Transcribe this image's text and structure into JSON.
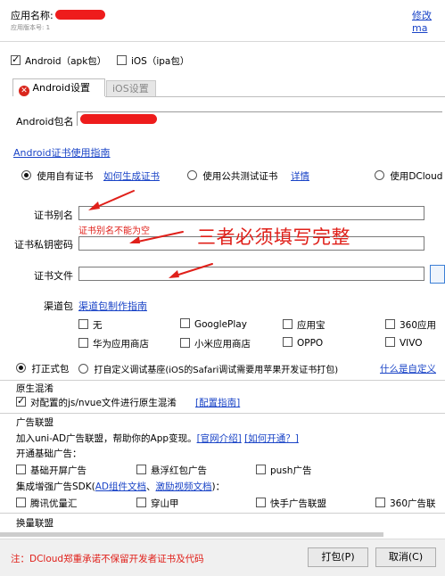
{
  "header": {
    "app_name_label": "应用名称:",
    "version_label": "应用版本号: 1",
    "modify_link": "修改ma"
  },
  "platforms": {
    "android_label": "Android（apk包）",
    "android_checked": true,
    "ios_label": "iOS（ipa包）",
    "ios_checked": false
  },
  "tabs": [
    {
      "label": "Android设置",
      "active": true
    },
    {
      "label": "iOS设置",
      "active": false
    }
  ],
  "android": {
    "package_label": "Android包名",
    "cert_guide_link": "Android证书使用指南",
    "cert_options": {
      "own": "使用自有证书",
      "how_to_link": "如何生成证书",
      "public": "使用公共测试证书",
      "detail_link": "详情",
      "dcloud": "使用DCloud"
    },
    "alias_label": "证书别名",
    "alias_error": "证书别名不能为空",
    "password_label": "证书私钥密码",
    "file_label": "证书文件",
    "annotation": "三者必须填写完整",
    "channel_label": "渠道包",
    "channel_guide_link": "渠道包制作指南",
    "channels_row1": [
      "无",
      "GooglePlay",
      "应用宝",
      "360应用"
    ],
    "channels_row2": [
      "华为应用商店",
      "小米应用商店",
      "OPPO",
      "VIVO"
    ]
  },
  "build_mode": {
    "formal": "打正式包",
    "custom": "打自定义调试基座(iOS的Safari调试需要用苹果开发证书打包)",
    "custom_link": "什么是自定义"
  },
  "native_obfuscation": {
    "title": "原生混淆",
    "option": "对配置的js/nvue文件进行原生混淆",
    "guide_link": "[配置指南]"
  },
  "ads": {
    "title": "广告联盟",
    "intro": "加入uni-AD广告联盟，帮助你的App变现。",
    "site_link": "[官网介绍]",
    "how_link": "[如何开通？]",
    "basic_title": "开通基础广告：",
    "basic": [
      "基础开屏广告",
      "悬浮红包广告",
      "push广告"
    ],
    "sdk_title_prefix": "集成增强广告SDK(",
    "sdk_link1": "AD组件文档",
    "sdk_sep": "、",
    "sdk_link2": "激励视频文档",
    "sdk_title_suffix": ")：",
    "sdk": [
      "腾讯优量汇",
      "穿山甲",
      "快手广告联盟",
      "360广告联"
    ]
  },
  "exchange": {
    "title": "换量联盟"
  },
  "footer": {
    "notice": "注：DCloud郑重承诺不保留开发者证书及代码",
    "pack_button": "打包(P)",
    "cancel_button": "取消(C)"
  },
  "colors": {
    "link": "#1a44c7",
    "warning_red": "#e0201a",
    "redaction": "#ee1c1c",
    "tab_active_bg": "#ffffff",
    "tab_inactive_bg": "#e6e6e6"
  }
}
